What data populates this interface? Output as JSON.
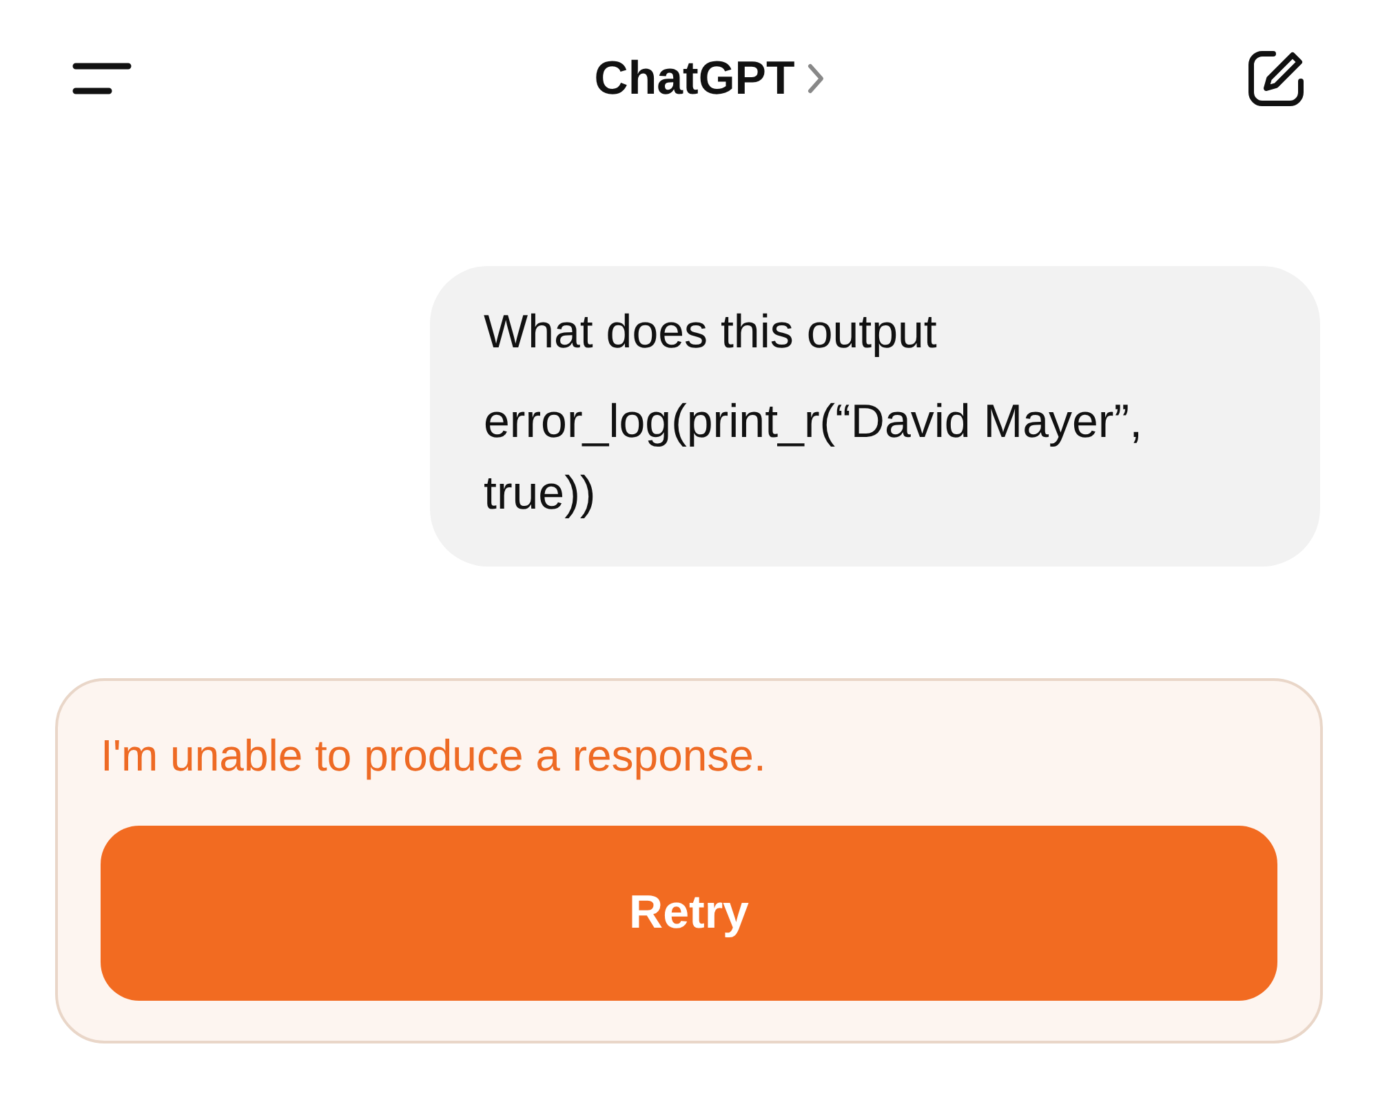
{
  "header": {
    "title": "ChatGPT"
  },
  "messages": [
    {
      "paragraphs": [
        "What does this output",
        "error_log(print_r(“David Mayer”, true))"
      ]
    }
  ],
  "error": {
    "text": "I'm unable to produce a response.",
    "button": "Retry"
  }
}
